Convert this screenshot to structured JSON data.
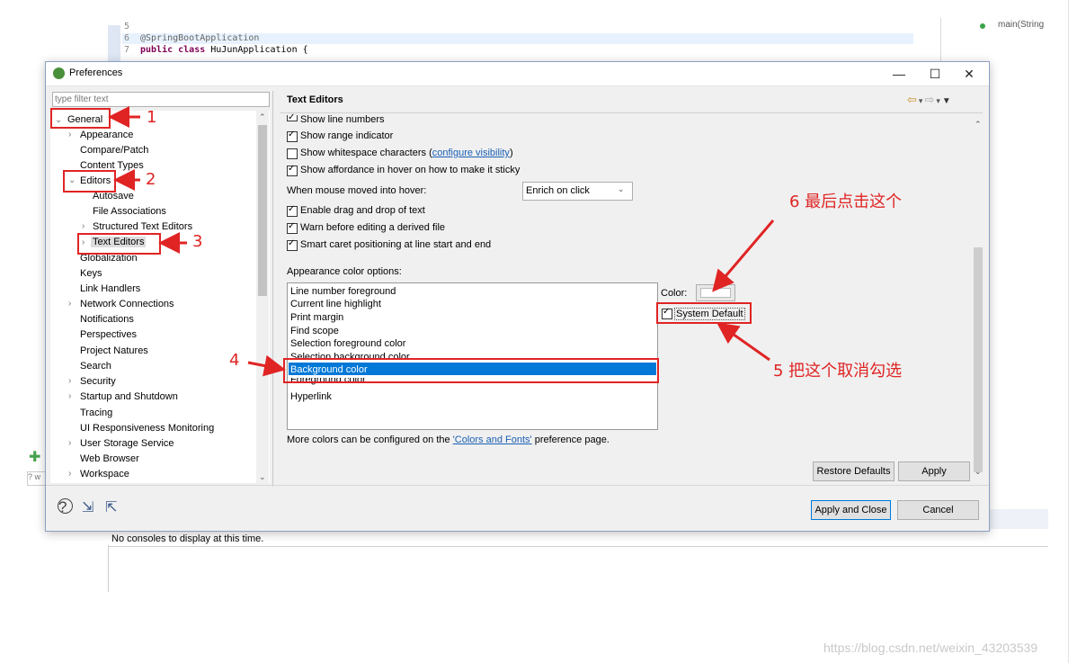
{
  "background": {
    "code_lines": [
      {
        "num": "5",
        "text": ""
      },
      {
        "num": "6",
        "text": "@SpringBootApplication"
      },
      {
        "num": "7",
        "text_kw": "public class",
        "text_rest": " HuJunApplication {"
      }
    ],
    "outline_item": "main(String",
    "console_message": "No consoles to display at this time.",
    "search_stub": "? w",
    "watermark": "https://blog.csdn.net/weixin_43203539"
  },
  "dialog": {
    "title": "Preferences",
    "window_controls": {
      "minimize": "—",
      "maximize": "☐",
      "close": "✕"
    },
    "filter_placeholder": "type filter text",
    "tree": [
      {
        "label": "General",
        "twisty": "expanded"
      },
      {
        "label": "Appearance",
        "twisty": "collapsed"
      },
      {
        "label": "Compare/Patch"
      },
      {
        "label": "Content Types"
      },
      {
        "label": "Editors",
        "twisty": "expanded"
      },
      {
        "label": "Autosave"
      },
      {
        "label": "File Associations"
      },
      {
        "label": "Structured Text Editors",
        "twisty": "collapsed"
      },
      {
        "label": "Text Editors",
        "twisty": "collapsed",
        "selected": true
      },
      {
        "label": "Globalization"
      },
      {
        "label": "Keys"
      },
      {
        "label": "Link Handlers"
      },
      {
        "label": "Network Connections",
        "twisty": "collapsed"
      },
      {
        "label": "Notifications"
      },
      {
        "label": "Perspectives"
      },
      {
        "label": "Project Natures"
      },
      {
        "label": "Search"
      },
      {
        "label": "Security",
        "twisty": "collapsed"
      },
      {
        "label": "Startup and Shutdown",
        "twisty": "collapsed"
      },
      {
        "label": "Tracing"
      },
      {
        "label": "UI Responsiveness Monitoring"
      },
      {
        "label": "User Storage Service",
        "twisty": "collapsed"
      },
      {
        "label": "Web Browser"
      },
      {
        "label": "Workspace",
        "twisty": "collapsed"
      }
    ],
    "page": {
      "title": "Text Editors",
      "options": [
        {
          "label": "Show line numbers",
          "checked": true
        },
        {
          "label": "Show range indicator",
          "checked": true
        },
        {
          "label": "Show whitespace characters (",
          "link": "configure visibility",
          "suffix": ")",
          "checked": false
        },
        {
          "label": "Show affordance in hover on how to make it sticky",
          "checked": true
        }
      ],
      "hover_label": "When mouse moved into hover:",
      "hover_value": "Enrich on click",
      "options2": [
        {
          "label": "Enable drag and drop of text",
          "checked": true
        },
        {
          "label": "Warn before editing a derived file",
          "checked": true
        },
        {
          "label": "Smart caret positioning at line start and end",
          "checked": true
        }
      ],
      "appearance_label": "Appearance color options:",
      "color_items": [
        "Line number foreground",
        "Current line highlight",
        "Print margin",
        "Find scope",
        "Selection foreground color",
        "Selection background color",
        "Background color",
        "Foreground color",
        "Hyperlink"
      ],
      "selected_color_item": "Background color",
      "color_label": "Color:",
      "system_default_label": "System Default",
      "system_default_checked": true,
      "more_colors_prefix": "More colors can be configured on the ",
      "more_colors_link": "'Colors and Fonts'",
      "more_colors_suffix": " preference page.",
      "restore_defaults": "Restore Defaults",
      "apply": "Apply"
    },
    "apply_and_close": "Apply and Close",
    "cancel": "Cancel"
  },
  "annotations": {
    "n1": "1",
    "n2": "2",
    "n3": "3",
    "n4": "4",
    "n5": "5 把这个取消勾选",
    "n6": "6 最后点击这个",
    "color": "#e02424"
  }
}
